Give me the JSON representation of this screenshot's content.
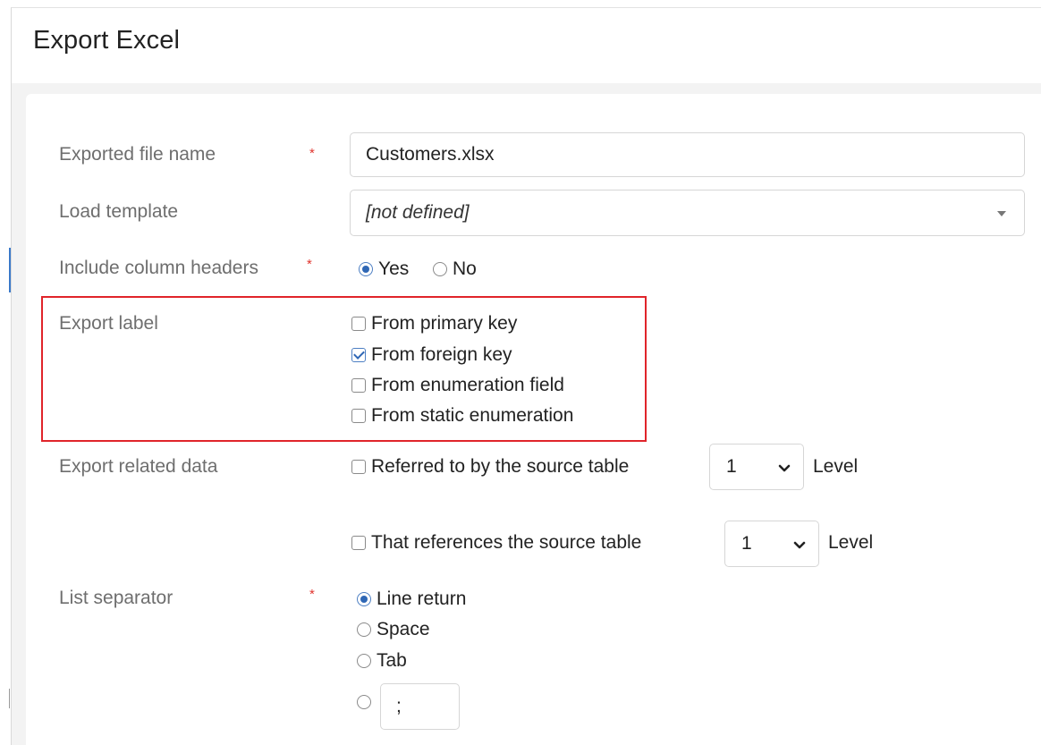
{
  "dialog": {
    "title": "Export Excel"
  },
  "form": {
    "file_name": {
      "label": "Exported file name",
      "value": "Customers.xlsx",
      "required": "*"
    },
    "template": {
      "label": "Load template",
      "value": "[not defined]"
    },
    "headers": {
      "label": "Include column headers",
      "required": "*",
      "options": [
        {
          "label": "Yes",
          "checked": true
        },
        {
          "label": "No",
          "checked": false
        }
      ]
    },
    "export_label": {
      "label": "Export label",
      "options": [
        {
          "label": "From primary key",
          "checked": false
        },
        {
          "label": "From foreign key",
          "checked": true
        },
        {
          "label": "From enumeration field",
          "checked": false
        },
        {
          "label": "From static enumeration",
          "checked": false
        }
      ]
    },
    "related_data": {
      "label": "Export related data",
      "referred_by": {
        "label": "Referred to by the source table",
        "checked": false,
        "level": "1",
        "level_label": "Level"
      },
      "references": {
        "label": "That references the source table",
        "checked": false,
        "level": "1",
        "level_label": "Level"
      }
    },
    "list_separator": {
      "label": "List separator",
      "required": "*",
      "options": [
        {
          "label": "Line return",
          "checked": true
        },
        {
          "label": "Space",
          "checked": false
        },
        {
          "label": "Tab",
          "checked": false
        }
      ],
      "custom_value": ";"
    }
  },
  "colors": {
    "accent": "#2f67b5",
    "required": "#e0342d",
    "highlight": "#e0242a",
    "label": "#6e6e6e"
  }
}
